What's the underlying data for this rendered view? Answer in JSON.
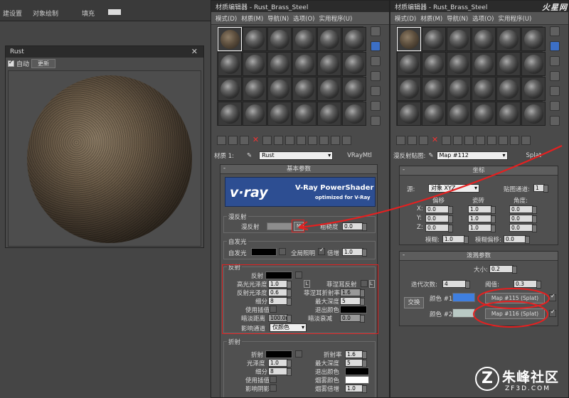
{
  "topbar": {
    "menus": [
      "建设置",
      "对象绘制",
      "填充"
    ]
  },
  "preview": {
    "title": "Rust",
    "auto_label": "自动",
    "update_label": "更新"
  },
  "editor1": {
    "title": "材质编辑器 - Rust_Brass_Steel",
    "menus": [
      "模式(D)",
      "材质(M)",
      "导航(N)",
      "选项(O)",
      "实用程序(U)"
    ],
    "material_label": "材质 1:",
    "material_name": "Rust",
    "material_type": "VRayMtl",
    "basic_params_title": "基本参数",
    "banner_logo": "v·ray",
    "banner_title": "V-Ray PowerShader",
    "banner_sub": "optimized for V-Ray",
    "diffuse": {
      "group": "漫反射",
      "label": "漫反射",
      "map_btn": "M",
      "roughness_label": "粗糙度",
      "roughness": "0.0"
    },
    "selfillum": {
      "group": "自发光",
      "label": "自发光",
      "gi_label": "全局照明",
      "mult_label": "倍增",
      "mult": "1.0"
    },
    "reflection": {
      "group": "反射",
      "reflect": "反射",
      "hilight_gloss": "高光光泽度",
      "hilight_gloss_val": "1.0",
      "l_btn": "L",
      "fresnel": "菲涅耳反射",
      "refl_gloss": "反射光泽度",
      "refl_gloss_val": "0.6",
      "fresnel_ior": "菲涅耳折射率",
      "fresnel_ior_val": "1.6",
      "subdivs": "细分",
      "subdivs_val": "8",
      "max_depth": "最大深度",
      "max_depth_val": "5",
      "use_interp": "使用插值",
      "exit_color": "退出颜色",
      "dim_dist": "暗淡距离",
      "dim_dist_val": "100.0m",
      "dim_falloff": "暗淡衰减",
      "dim_falloff_val": "0.0",
      "affect_channels": "影响通道",
      "affect_val": "仅颜色"
    },
    "refraction": {
      "group": "折射",
      "refract": "折射",
      "ior": "折射率",
      "ior_val": "1.6",
      "gloss": "光泽度",
      "gloss_val": "1.0",
      "max_depth": "最大深度",
      "max_depth_val": "5",
      "subdivs": "细分",
      "subdivs_val": "8",
      "exit_color": "退出颜色",
      "use_interp": "使用插值",
      "fog_color": "烟雾颜色",
      "affect_shadows": "影响阴影",
      "fog_mult": "烟雾倍增",
      "fog_mult_val": "1.0"
    }
  },
  "editor2": {
    "title": "材质编辑器 - Rust_Brass_Steel",
    "menus": [
      "模式(D)",
      "材质(M)",
      "导航(N)",
      "选项(O)",
      "实用程序(U)"
    ],
    "map_label": "漫反射贴图:",
    "map_name": "Map #112",
    "map_type": "Splat",
    "coords_title": "坐标",
    "source_label": "源:",
    "source_val": "对象 XYZ",
    "channel_label": "贴图通道:",
    "channel_val": "1",
    "col_offset": "偏移",
    "col_tiling": "瓷砖",
    "col_angle": "角度:",
    "rows": [
      {
        "axis": "X:",
        "offset": "0.0",
        "tiling": "1.0",
        "angle": "0.0"
      },
      {
        "axis": "Y:",
        "offset": "0.0",
        "tiling": "1.0",
        "angle": "0.0"
      },
      {
        "axis": "Z:",
        "offset": "0.0",
        "tiling": "1.0",
        "angle": "0.0"
      }
    ],
    "blur_label": "模糊:",
    "blur_val": "1.0",
    "blur_offset_label": "模糊偏移:",
    "blur_offset_val": "0.0",
    "splat_title": "泼溅参数",
    "size_label": "大小:",
    "size_val": "0.2",
    "iter_label": "迭代次数:",
    "iter_val": "4",
    "thresh_label": "阈值:",
    "thresh_val": "0.3",
    "swap_label": "交换",
    "color1_label": "颜色 #1",
    "color1_map": "Map #115 (Splat)",
    "color2_label": "颜色 #2",
    "color2_map": "Map #116 (Splat)",
    "color1_hex": "#3f7fe0",
    "color2_hex": "#b9c9c4"
  },
  "watermark": {
    "top": "火星网",
    "bottom": "朱峰社区",
    "bottom_sub": "ZF3D.COM"
  }
}
